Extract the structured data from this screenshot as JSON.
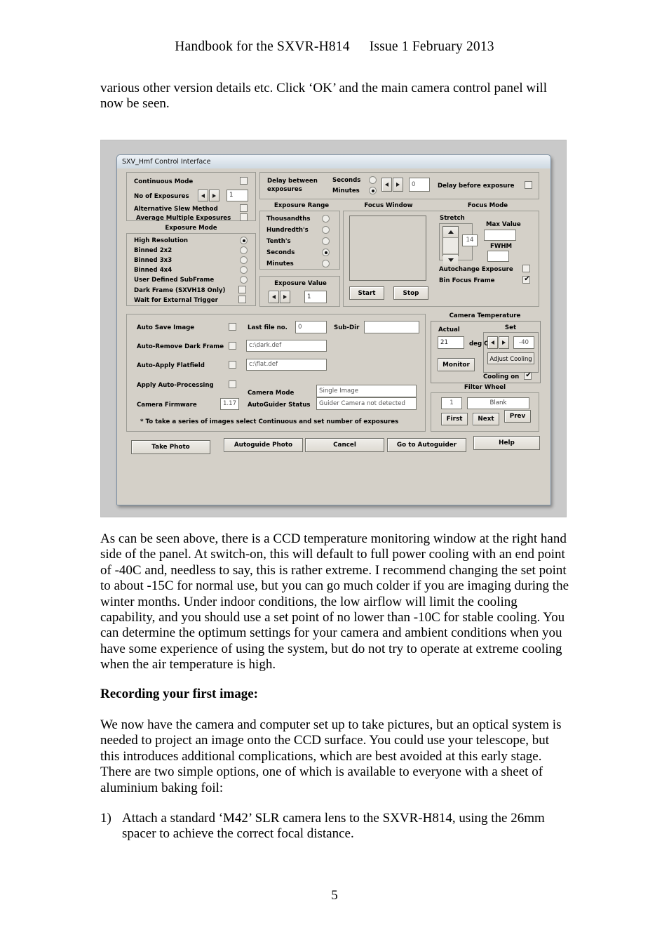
{
  "header": {
    "title": "Handbook for the SXVR-H814",
    "issue": "Issue 1 February 2013"
  },
  "page_number": "5",
  "paragraphs": {
    "intro": "various other version details etc. Click ‘OK’ and the main camera control panel will now be seen.",
    "ccd": "As can be seen above, there is a CCD temperature monitoring window at the right hand side of the panel. At switch-on, this will default to full power cooling with an end point of -40C and, needless to say, this is rather extreme. I recommend changing the set point to about -15C for normal use, but you can go much colder if you are imaging during the winter months. Under indoor conditions, the low airflow will limit the cooling capability, and you should use a set point of no lower than -10C for stable cooling. You can determine the optimum settings for your camera and ambient conditions when you have some experience of using the system, but do not try to operate at extreme cooling when the air temperature is high.",
    "recording_heading": "Recording your first image:",
    "recording": "We now have the camera and computer set up to take pictures, but an optical system is needed to project an image onto the CCD surface. You could use your telescope, but this introduces additional complications, which are best avoided at this early stage. There are two simple options, one of which is available to everyone with a sheet of aluminium baking foil:"
  },
  "list": [
    {
      "num": "1)",
      "text": "Attach a standard ‘M42’ SLR camera lens to the SXVR-H814, using the 26mm spacer to achieve the correct focal distance."
    }
  ],
  "dialog": {
    "title": "SXV_Hmf Control Interface",
    "top_left": {
      "continuous_mode": {
        "label": "Continuous Mode",
        "checked": false
      },
      "no_of_exposures": {
        "label": "No of Exposures",
        "value": "1"
      },
      "alternative_slew": {
        "label": "Alternative Slew Method",
        "checked": false
      },
      "average_multiple": {
        "label": "Average Multiple Exposures",
        "checked": false
      }
    },
    "exposure_mode": {
      "group_label": "Exposure Mode",
      "radios": [
        {
          "label": "High Resolution",
          "selected": true
        },
        {
          "label": "Binned 2x2",
          "selected": false
        },
        {
          "label": "Binned 3x3",
          "selected": false
        },
        {
          "label": "Binned 4x4",
          "selected": false
        },
        {
          "label": "User Defined SubFrame",
          "selected": false
        }
      ],
      "checks": [
        {
          "label": "Dark Frame (SXVH18 Only)",
          "checked": false
        },
        {
          "label": "Wait for External Trigger",
          "checked": false
        }
      ]
    },
    "delay": {
      "label_line1": "Delay between",
      "label_line2": "exposures",
      "seconds": "Seconds",
      "minutes": "Minutes",
      "selected": "Minutes",
      "value": "0",
      "before_exposure": {
        "label": "Delay before exposure",
        "checked": false
      }
    },
    "exposure_range": {
      "group_label": "Exposure Range",
      "radios": [
        {
          "label": "Thousandths",
          "selected": false
        },
        {
          "label": "Hundredth's",
          "selected": false
        },
        {
          "label": "Tenth's",
          "selected": false
        },
        {
          "label": "Seconds",
          "selected": true
        },
        {
          "label": "Minutes",
          "selected": false
        }
      ]
    },
    "exposure_value": {
      "group_label": "Exposure Value",
      "value": "1"
    },
    "focus_window": {
      "group_label": "Focus Window",
      "start": "Start",
      "stop": "Stop"
    },
    "focus_mode": {
      "group_label": "Focus Mode",
      "stretch_label": "Stretch",
      "stretch_value": "14",
      "max_value_label": "Max Value",
      "max_value": "",
      "fwhm_label": "FWHM",
      "fwhm": "",
      "autochange_exposure": {
        "label": "Autochange Exposure",
        "checked": false
      },
      "bin_focus_frame": {
        "label": "Bin Focus Frame",
        "checked": true
      }
    },
    "files": {
      "auto_save": {
        "label": "Auto Save Image",
        "checked": false
      },
      "last_file_no": {
        "label": "Last file no.",
        "value": "0"
      },
      "sub_dir": {
        "label": "Sub-Dir",
        "value": ""
      },
      "auto_remove_dark": {
        "label": "Auto-Remove Dark Frame",
        "checked": false,
        "path": "c:\\dark.def"
      },
      "auto_apply_flat": {
        "label": "Auto-Apply Flatfield",
        "checked": false,
        "path": "c:\\flat.def"
      },
      "apply_auto_processing": {
        "label": "Apply Auto-Processing",
        "checked": false
      },
      "camera_firmware": {
        "label": "Camera Firmware",
        "value": "1.17"
      },
      "camera_mode": {
        "label": "Camera Mode",
        "value": "Single Image"
      },
      "autoguider_status": {
        "label": "AutoGuider Status",
        "value": "Guider Camera not detected"
      },
      "footnote": "* To take a series of images select Continuous and set number of exposures"
    },
    "camera_temperature": {
      "group_label": "Camera Temperature",
      "actual_label": "Actual",
      "actual_value": "21",
      "deg_label": "deg C",
      "set_label": "Set",
      "set_value": "-40",
      "adjust_cooling": "Adjust Cooling",
      "monitor": "Monitor",
      "cooling_on": {
        "label": "Cooling on",
        "checked": true
      }
    },
    "filter_wheel": {
      "group_label": "Filter Wheel",
      "position": "1",
      "name": "Blank",
      "first": "First",
      "next": "Next",
      "prev": "Prev"
    },
    "actions": {
      "take_photo": "Take Photo",
      "autoguide_photo": "Autoguide Photo",
      "cancel": "Cancel",
      "go_to_autoguider": "Go to Autoguider",
      "help": "Help"
    }
  }
}
